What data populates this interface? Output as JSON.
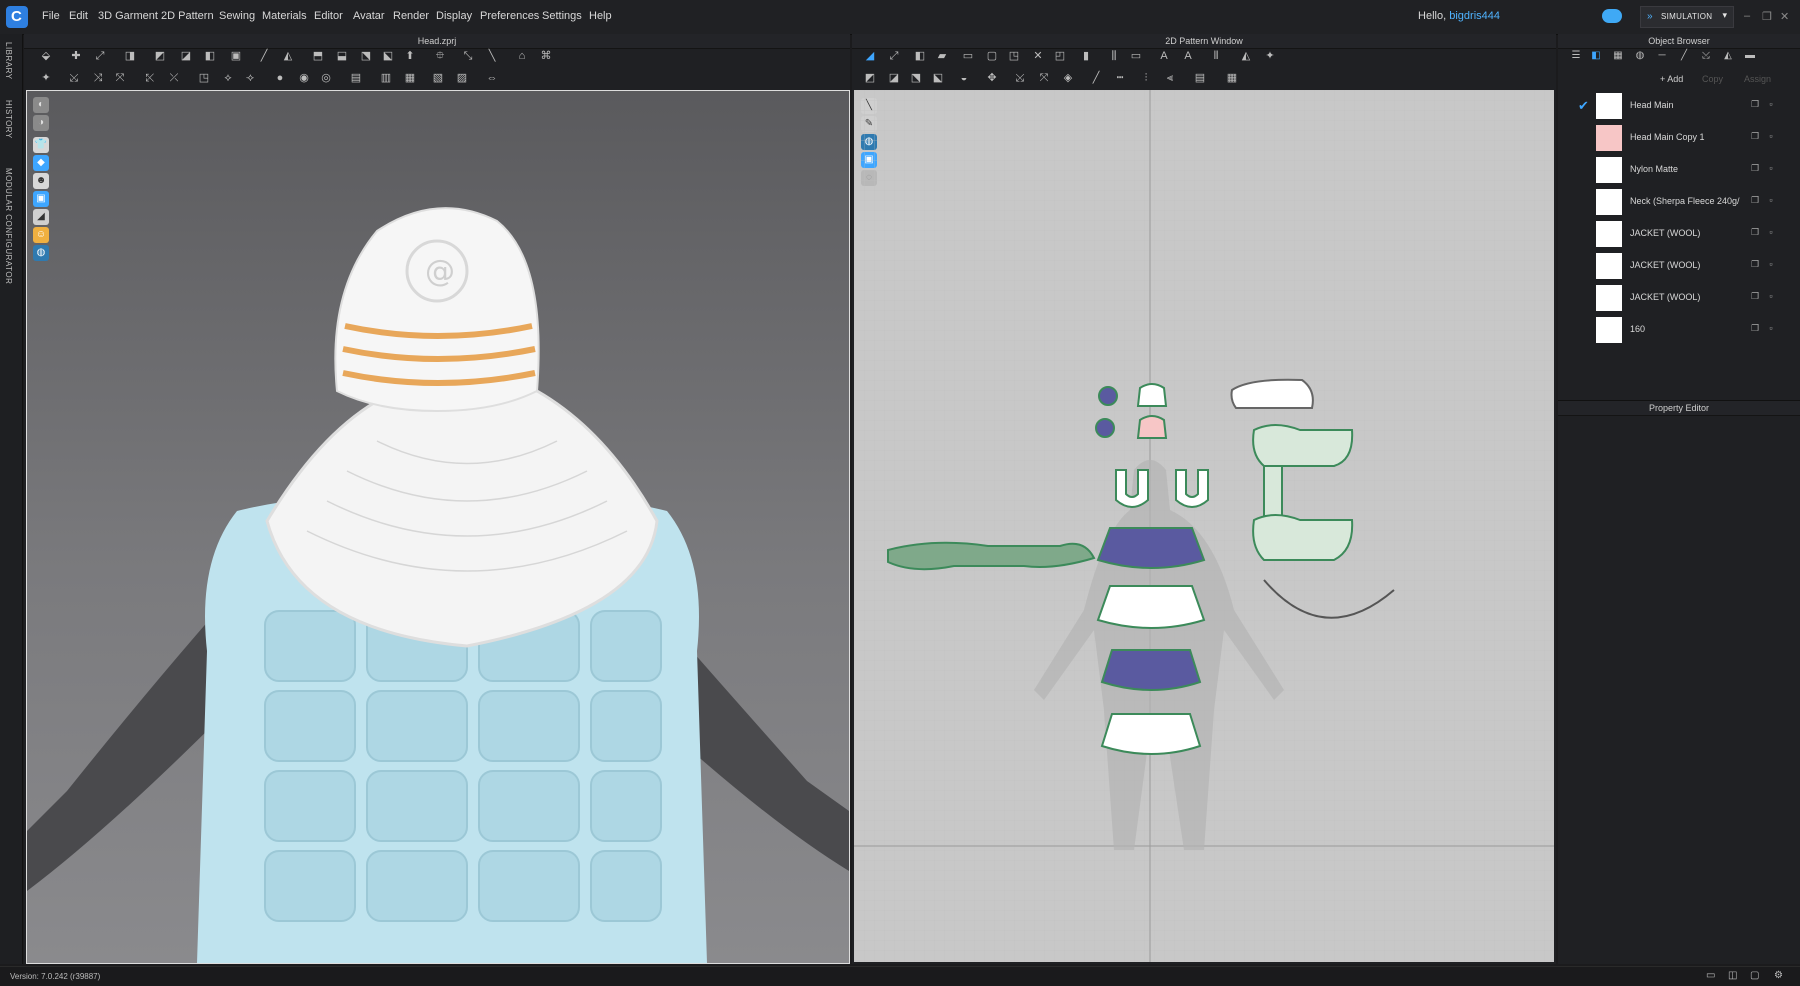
{
  "app": {
    "logo": "C"
  },
  "menu": [
    "File",
    "Edit",
    "3D Garment",
    "2D Pattern",
    "Sewing",
    "Materials",
    "Editor",
    "Avatar",
    "Render",
    "Display",
    "Preferences",
    "Settings",
    "Help"
  ],
  "user": {
    "greeting": "Hello,",
    "name": "bigdris444"
  },
  "simulation": {
    "label": "SIMULATION"
  },
  "side_tabs": [
    "LIBRARY",
    "HISTORY",
    "MODULAR CONFIGURATOR"
  ],
  "panels": {
    "three_d": {
      "title": "Head.zprj"
    },
    "two_d": {
      "title": "2D Pattern Window"
    },
    "object_browser": {
      "title": "Object Browser",
      "add": "+ Add",
      "copy": "Copy",
      "assign": "Assign"
    },
    "property_editor": {
      "title": "Property Editor"
    }
  },
  "objects": [
    {
      "label": "Head Main",
      "color": "#ffffff",
      "checked": true
    },
    {
      "label": "Head Main Copy 1",
      "color": "#f7c6c6",
      "checked": false
    },
    {
      "label": "Nylon Matte",
      "color": "#ffffff",
      "checked": false
    },
    {
      "label": "Neck (Sherpa Fleece 240g/...",
      "color": "#ffffff",
      "checked": false
    },
    {
      "label": "JACKET (WOOL)",
      "color": "#ffffff",
      "checked": false
    },
    {
      "label": "JACKET (WOOL)",
      "color": "#ffffff",
      "checked": false
    },
    {
      "label": "JACKET (WOOL)",
      "color": "#ffffff",
      "checked": false
    },
    {
      "label": "160",
      "color": "#ffffff",
      "checked": false
    }
  ],
  "status": {
    "version": "Version: 7.0.242 (r39887)"
  },
  "colors": {
    "accent": "#3ea6ff",
    "garment_vest": "#bfe3ee",
    "hood_stripe": "#e8a75a",
    "pattern_outline": "#3c8a5a"
  }
}
